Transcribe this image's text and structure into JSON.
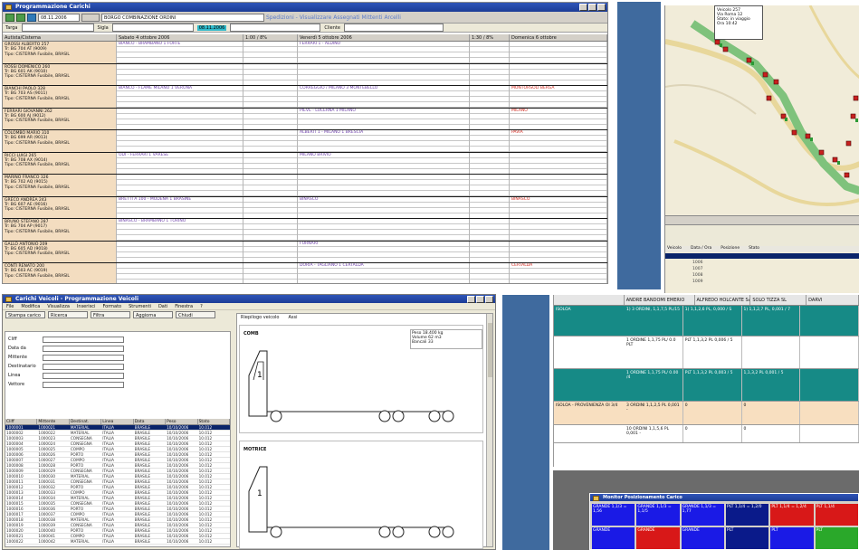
{
  "colors": {
    "band": "#3f6a9e",
    "teal": "#168a86",
    "peach": "#f3ddc0",
    "selection": "#0a246a",
    "map_route": "#7fc27c"
  },
  "planning": {
    "title": "Programmazione Carichi",
    "toolbar_date": "08.11.2006",
    "toolbar_field": "BORGO COMBINAZIONE ORDINI",
    "toolbar_link": "Spedizioni - Visualizzare Assegnati Mittenti Arcelli",
    "filters": [
      "Targa",
      "Sigla",
      "Cliente"
    ],
    "filter_highlight": "08.11.2006",
    "headers": [
      "Autista/Cisterna",
      "Sabato 4 ottobre 2006",
      "1:00 / 8%",
      "Venerdì 5 ottobre 2006",
      "1:30 / 8%",
      "Domenica 6 ottobre"
    ],
    "rows": [
      {
        "driver": [
          "GROSSI ALBERTO   257",
          "Tr: BG 704 AT (9009)",
          "Tipo: CISTERNA Fusibile, BRASIL"
        ],
        "c1": "BIANCO - BRAMBANO 1 FORTE",
        "c3": "FERRARI 1 - ALDINO",
        "c5": ""
      },
      {
        "driver": [
          "ROSSI DOMENICO   260",
          "Tr: BG 601 AK (9010)",
          "Tipo: CISTERNA Fusibile, BRASIL"
        ],
        "c1": "",
        "c3": "",
        "c5": ""
      },
      {
        "driver": [
          "BIANCHI PAOLO   328",
          "Tr: BG 703 AS (9011)",
          "Tipo: CISTERNA Fusibile, BRASIL"
        ],
        "c1": "BIANCO - FLAME MILANO 1 VERONA",
        "c3": "CORREGGIO / MILANO 3 MONTEBELLO",
        "c5": "MONTORSOLI BERGA"
      },
      {
        "driver": [
          "FERRARI GIOVANNI   262",
          "Tr: BG 600 AJ (9012)",
          "Tipo: CISTERNA Fusibile, BRASIL"
        ],
        "c1": "",
        "c3": "PIEVE - LUCERNA 1 MILANO",
        "c5": "MILANO"
      },
      {
        "driver": [
          "COLOMBO MARIO   310",
          "Tr: BG 699 AR (9013)",
          "Tipo: CISTERNA Fusibile, BRASIL"
        ],
        "c1": "",
        "c3": "ALBERTI 1 - MILANO 1 BRESCIA",
        "c5": "PAVIA"
      },
      {
        "driver": [
          "RICCI LUIGI   265",
          "Tr: BG 708 AX (9014)",
          "Tipo: CISTERNA Fusibile, BRASIL"
        ],
        "c1": "ODI - FERRARI 1 VARESE",
        "c3": "MILANO BRIVIO",
        "c5": ""
      },
      {
        "driver": [
          "MARINO FRANCO   326",
          "Tr: BG 702 AQ (9015)",
          "Tipo: CISTERNA Fusibile, BRASIL"
        ],
        "c1": "",
        "c3": "",
        "c5": ""
      },
      {
        "driver": [
          "GRECO ANDREA   243",
          "Tr: BG 607 AE (9016)",
          "Tipo: CISTERNA Fusibile, BRASIL"
        ],
        "c1": "BRETTI A 100 - MODENA 1 BRASINE",
        "c3": "BINASCO",
        "c5": "BINASCO"
      },
      {
        "driver": [
          "BRUNO STEFANO   287",
          "Tr: BG 704 AP (9017)",
          "Tipo: CISTERNA Fusibile, BRASIL"
        ],
        "c1": "BINASCO - BRAMBANO 1 TORINO",
        "c3": "",
        "c5": ""
      },
      {
        "driver": [
          "GALLO ANTONIO   209",
          "Tr: BG 605 AD (9018)",
          "Tipo: CISTERNA Fusibile, BRASIL"
        ],
        "c1": "",
        "c3": "FORNARI",
        "c5": ""
      },
      {
        "driver": [
          "CONTI RENATO   200",
          "Tr: BG 603 AC (9019)",
          "Tipo: CISTERNA Fusibile, BRASIL"
        ],
        "c1": "",
        "c3": "DORIA - TAGLIANO 1 CERTALDA",
        "c5": "CERTALDA"
      },
      {
        "driver": [
          "DE LUCA SERGIO",
          "Tr: BG 602 AB (9020)",
          "Tipo: CISTERNA Fusibile, BRASIL"
        ],
        "c1": "",
        "c3": "",
        "c5": ""
      }
    ]
  },
  "map": {
    "popup": [
      "Veicolo 257",
      "Via Roma 12",
      "Stato: in viaggio",
      "Ora 10:42"
    ],
    "list_headers": [
      "Veicolo",
      "Data / Ora",
      "Posizione",
      "Stato"
    ],
    "list_items": [
      "1006",
      "1007",
      "1008",
      "1009"
    ]
  },
  "loading": {
    "title": "Carichi Veicoli - Programmazione Veicoli",
    "menu": [
      "File",
      "Modifica",
      "Visualizza",
      "Inserisci",
      "Formato",
      "Strumenti",
      "Dati",
      "Finestra",
      "?"
    ],
    "toolbar": [
      "Stampa carico",
      "Ricerca",
      "Filtra",
      "Aggiorna",
      "Chiudi"
    ],
    "form_labels": [
      "Cliff",
      "Data da",
      "Mittente",
      "Destinatario",
      "Linea",
      "Vettore"
    ],
    "right_header": [
      "Riepilogo veicolo",
      "Assi"
    ],
    "vehicle_labels": [
      "COMB",
      "MOTRICE"
    ],
    "note": [
      "Peso 18.400 kg",
      "Volume 62 m3",
      "Bancali 33"
    ],
    "table_headers": [
      "Cliff",
      "Mittente",
      "Destinat.",
      "Linea",
      "Data",
      "Peso",
      "Stato"
    ],
    "table_rows": [
      [
        "1000001",
        "1000021",
        "MATERIAL",
        "ITALIA",
        "BRASILE",
        "10/10/2006",
        "10.012"
      ],
      [
        "1000002",
        "1000022",
        "MATERIAL",
        "ITALIA",
        "BRASILE",
        "10/10/2006",
        "10.012"
      ],
      [
        "1000003",
        "1000023",
        "CONSEGNA",
        "ITALIA",
        "BRASILE",
        "10/10/2006",
        "10.012"
      ],
      [
        "1000004",
        "1000024",
        "CONSEGNA",
        "ITALIA",
        "BRASILE",
        "10/10/2006",
        "10.012"
      ],
      [
        "1000005",
        "1000025",
        "COMPO",
        "ITALIA",
        "BRASILE",
        "10/10/2006",
        "10.012"
      ],
      [
        "1000006",
        "1000026",
        "PORTO",
        "ITALIA",
        "BRASILE",
        "10/10/2006",
        "10.012"
      ],
      [
        "1000007",
        "1000027",
        "COMPO",
        "ITALIA",
        "BRASILE",
        "10/10/2006",
        "10.012"
      ],
      [
        "1000008",
        "1000028",
        "PORTO",
        "ITALIA",
        "BRASILE",
        "10/10/2006",
        "10.012"
      ],
      [
        "1000009",
        "1000029",
        "CONSEGNA",
        "ITALIA",
        "BRASILE",
        "10/10/2006",
        "10.012"
      ],
      [
        "1000010",
        "1000030",
        "MATERIAL",
        "ITALIA",
        "BRASILE",
        "10/10/2006",
        "10.012"
      ],
      [
        "1000011",
        "1000031",
        "CONSEGNA",
        "ITALIA",
        "BRASILE",
        "10/10/2006",
        "10.012"
      ],
      [
        "1000012",
        "1000032",
        "PORTO",
        "ITALIA",
        "BRASILE",
        "10/10/2006",
        "10.012"
      ],
      [
        "1000013",
        "1000033",
        "COMPO",
        "ITALIA",
        "BRASILE",
        "10/10/2006",
        "10.012"
      ],
      [
        "1000014",
        "1000034",
        "MATERIAL",
        "ITALIA",
        "BRASILE",
        "10/10/2006",
        "10.012"
      ],
      [
        "1000015",
        "1000035",
        "CONSEGNA",
        "ITALIA",
        "BRASILE",
        "10/10/2006",
        "10.012"
      ],
      [
        "1000016",
        "1000036",
        "PORTO",
        "ITALIA",
        "BRASILE",
        "10/10/2006",
        "10.012"
      ],
      [
        "1000017",
        "1000037",
        "COMPO",
        "ITALIA",
        "BRASILE",
        "10/10/2006",
        "10.012"
      ],
      [
        "1000018",
        "1000038",
        "MATERIAL",
        "ITALIA",
        "BRASILE",
        "10/10/2006",
        "10.012"
      ],
      [
        "1000019",
        "1000039",
        "CONSEGNA",
        "ITALIA",
        "BRASILE",
        "10/10/2006",
        "10.012"
      ],
      [
        "1000020",
        "1000040",
        "PORTO",
        "ITALIA",
        "BRASILE",
        "10/10/2006",
        "10.012"
      ],
      [
        "1000021",
        "1000041",
        "COMPO",
        "ITALIA",
        "BRASILE",
        "10/10/2006",
        "10.012"
      ],
      [
        "1000022",
        "1000042",
        "MATERIAL",
        "ITALIA",
        "BRASILE",
        "10/10/2006",
        "10.012"
      ]
    ]
  },
  "matrix": {
    "headers": [
      "",
      "ANDRE BANDOMI EMERIO",
      "ALFREDO HOLCANTE SAL",
      "SOLO TIZZA SL",
      "DARVI"
    ],
    "rows": [
      {
        "label": "ISOLOA",
        "style": "teal",
        "cells": [
          "1) 3 ORDINI, 1,1,7,5 PL/15",
          "1) 1,1,2,6 PL, 0,000 / S",
          "1) 1,1,2,7 PL, 0,001 / 7",
          ""
        ]
      },
      {
        "label": "",
        "style": "white",
        "cells": [
          "1 ORDINE 1,1,75 PL/ 0.0 PLT",
          "PLT 1,1,3,2 PL 0,006 / 5",
          "",
          ""
        ]
      },
      {
        "label": "",
        "style": "teal",
        "cells": [
          "1 ORDINE 1,1,75 PL/ 0.00 /4",
          "PLT 1,1,3,2 PL 0,003 / 5",
          "1,1,3,2 PL 0,001 / 5",
          ""
        ]
      },
      {
        "label": "ISOLOA - PROVENIENZA OI 3/4",
        "style": "peach",
        "cells": [
          "3 ORDINI 1,1,2,5 PL 0,001 -",
          "0",
          "0",
          ""
        ]
      },
      {
        "label": "",
        "style": "white",
        "cells": [
          "10 ORDINI 1,1,5,6 PL 0,001 -",
          "0",
          "0",
          ""
        ]
      }
    ]
  },
  "positions": {
    "title": "Monitor Posizionamento Carico",
    "blocks": [
      {
        "text": "GRANDE 1,1/3 = 1,56",
        "color": "#1a1ae6"
      },
      {
        "text": "GRANDE 1,1/3 = 1,1/5",
        "color": "#1a1ae6"
      },
      {
        "text": "GRANDE 1,1/3 = 1,77",
        "color": "#1a1ae6"
      },
      {
        "text": "PLT 1,1/4 = 1,2/0",
        "color": "#0a1a8a"
      },
      {
        "text": "PLT 1,1/4 = 1,2/4",
        "color": "#d81818"
      },
      {
        "text": "PLT 1,1/4",
        "color": "#d81818"
      },
      {
        "text": "GRANDE",
        "color": "#1a1ae6"
      },
      {
        "text": "GRANDE",
        "color": "#d81818"
      },
      {
        "text": "GRANDE",
        "color": "#1a1ae6"
      },
      {
        "text": "PLT",
        "color": "#0a1a8a"
      },
      {
        "text": "PLT",
        "color": "#1a1ae6"
      },
      {
        "text": "PLT",
        "color": "#2aa82a"
      }
    ]
  }
}
